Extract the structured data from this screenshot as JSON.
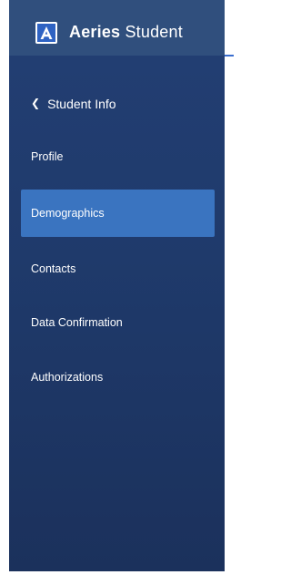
{
  "brand": {
    "name_bold": "Aeries",
    "name_light": "Student",
    "logo_letter": "A"
  },
  "nav": {
    "back_label": "Student Info",
    "items": [
      {
        "label": "Profile",
        "active": false
      },
      {
        "label": "Demographics",
        "active": true
      },
      {
        "label": "Contacts",
        "active": false
      },
      {
        "label": "Data Confirmation",
        "active": false
      },
      {
        "label": "Authorizations",
        "active": false
      }
    ]
  },
  "colors": {
    "sidebar": "#1f3a6b",
    "brand_bar": "#304f7d",
    "active_item": "#3a74c0",
    "logo_blue": "#2f63c3"
  }
}
